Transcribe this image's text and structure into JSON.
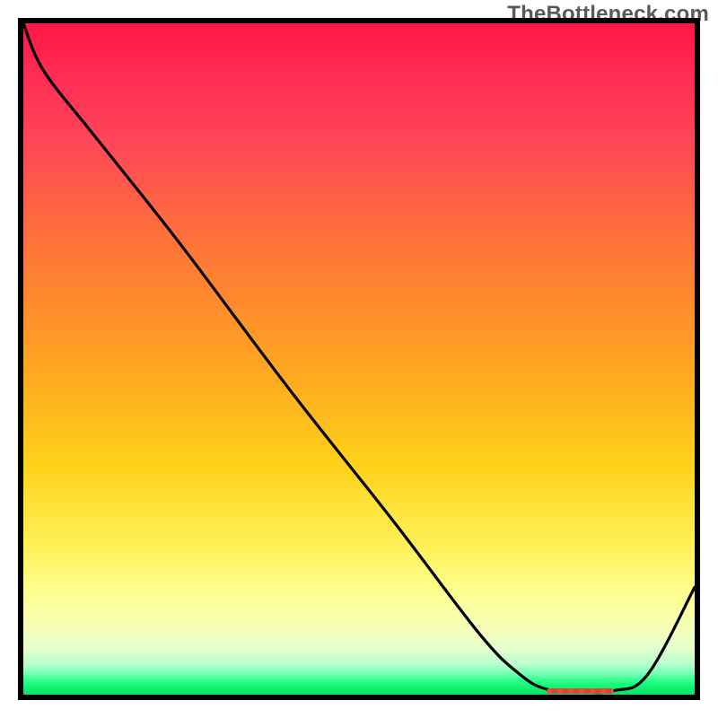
{
  "watermark": "TheBottleneck.com",
  "colors": {
    "frame": "#000000",
    "curve": "#000000",
    "marker": "#e74c3c",
    "gradient_top": "#ff1744",
    "gradient_bottom": "#05e060"
  },
  "chart_data": {
    "type": "line",
    "title": "",
    "xlabel": "",
    "ylabel": "",
    "xlim": [
      0,
      100
    ],
    "ylim": [
      0,
      100
    ],
    "x": [
      0,
      3,
      10,
      18,
      25,
      40,
      55,
      68,
      74,
      78,
      83,
      88,
      93,
      100
    ],
    "values": [
      100,
      93,
      84,
      74,
      65,
      45,
      26,
      9,
      3,
      0.8,
      0.4,
      0.6,
      3,
      16
    ],
    "marker": {
      "x_start": 78,
      "x_end": 88,
      "y": 0.6
    },
    "note": "Values are percent of plot height from the bottom (0 = bottom/green, 100 = top/red). X values are percent of plot width from the left. Curve read from gradient heat chart; minimum near x≈83."
  }
}
